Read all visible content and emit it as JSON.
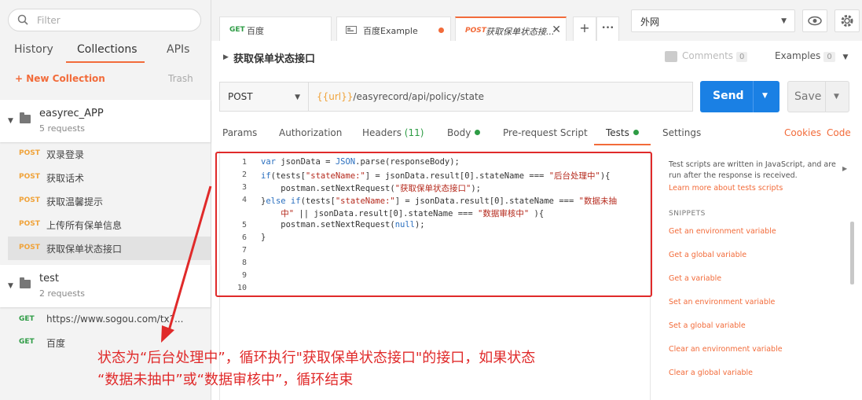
{
  "sidebar": {
    "filter_placeholder": "Filter",
    "tabs": [
      "History",
      "Collections",
      "APIs"
    ],
    "new_collection": "+ New Collection",
    "trash": "Trash",
    "collections": [
      {
        "name": "easyrec_APP",
        "count": "5 requests"
      },
      {
        "name": "test",
        "count": "2 requests"
      }
    ],
    "requests_easyrec": [
      {
        "method": "POST",
        "title": "双录登录"
      },
      {
        "method": "POST",
        "title": "获取话术"
      },
      {
        "method": "POST",
        "title": "获取温馨提示"
      },
      {
        "method": "POST",
        "title": "上传所有保单信息"
      },
      {
        "method": "POST",
        "title": "获取保单状态接口"
      }
    ],
    "requests_test": [
      {
        "method": "GET",
        "title": "https://www.sogou.com/tx?..."
      },
      {
        "method": "GET",
        "title": "百度"
      }
    ]
  },
  "tabs": [
    {
      "method": "GET",
      "title": "百度"
    },
    {
      "method": "",
      "title": "百度Example"
    },
    {
      "method": "POST",
      "title": "获取保单状态接..."
    }
  ],
  "tab_buttons": {
    "add": "+",
    "more": "•••"
  },
  "environment": {
    "selected": "外网"
  },
  "request": {
    "name": "获取保单状态接口",
    "comments_label": "Comments",
    "comments_count": "0",
    "examples_label": "Examples",
    "examples_count": "0",
    "method": "POST",
    "url_var": "{{url}}",
    "url_path": "/easyrecord/api/policy/state",
    "send": "Send",
    "save": "Save"
  },
  "subtabs": {
    "params": "Params",
    "authorization": "Authorization",
    "headers": "Headers",
    "headers_count": "(11)",
    "body": "Body",
    "prerequest": "Pre-request Script",
    "tests": "Tests",
    "settings": "Settings",
    "cookies": "Cookies",
    "code": "Code"
  },
  "editor": {
    "line_numbers": [
      "1",
      "2",
      "3",
      "4",
      "",
      "5",
      "6",
      "7",
      "8",
      "9",
      "10"
    ]
  },
  "snippets": {
    "info": "Test scripts are written in JavaScript, and are run after the response is received.",
    "learn": "Learn more about tests scripts",
    "heading": "SNIPPETS",
    "items": [
      "Get an environment variable",
      "Get a global variable",
      "Get a variable",
      "Set an environment variable",
      "Set a global variable",
      "Clear an environment variable",
      "Clear a global variable"
    ]
  },
  "annotation": {
    "line1": "状态为“后台处理中”，循环执行\"获取保单状态接口\"的接口，如果状态",
    "line2": "“数据未抽中”或“数据审核中”，循环结束"
  },
  "colors": {
    "accent": "#f26b3a",
    "send": "#1a80e4",
    "annotation": "#e02a2a",
    "get": "#2e9c45",
    "post": "#f0a33a"
  }
}
